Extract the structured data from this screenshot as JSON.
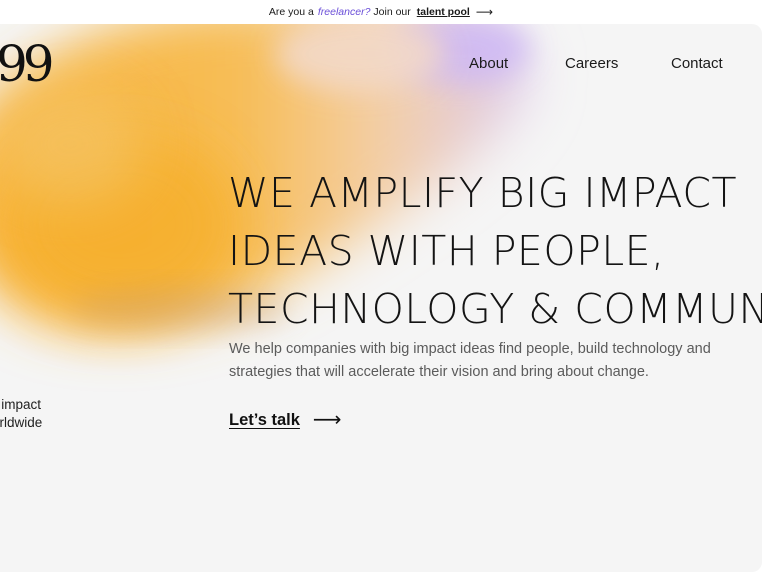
{
  "announcement": {
    "prefix": "Are you a",
    "emphasis": "freelancer?",
    "middle": "Join our",
    "link": "talent pool",
    "arrow": "⟶"
  },
  "logo": {
    "text": "99"
  },
  "nav": {
    "items": [
      {
        "label": "About"
      },
      {
        "label": "Careers"
      },
      {
        "label": "Contact"
      }
    ]
  },
  "hero": {
    "headline_lines": [
      "WE AMPLIFY BIG IMPACT",
      "IDEAS WITH PEOPLE,",
      "TECHNOLOGY & COMMUNITY"
    ],
    "subtitle_lines": [
      "We help companies with big impact ideas find people, build technology and",
      "strategies that will accelerate their vision and bring about change."
    ],
    "cta_label": "Let’s talk",
    "cta_arrow": "⟶"
  },
  "side_note": {
    "lines": [
      "n impact",
      "orldwide"
    ]
  },
  "colors": {
    "background": "#f5f5f5",
    "accent_orange": "#f9b53a",
    "accent_purple": "#c9b6f2",
    "link_italic": "#6b4fd8"
  }
}
